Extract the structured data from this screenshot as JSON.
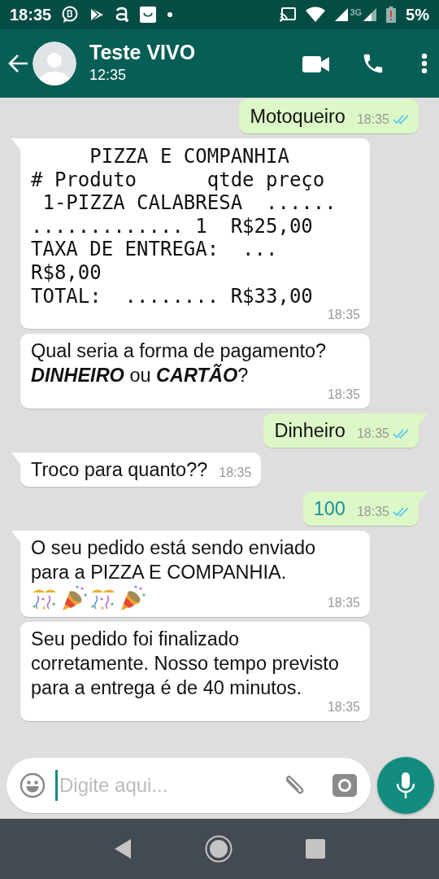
{
  "status_bar": {
    "time": "18:35",
    "battery": "5%",
    "network": "3G"
  },
  "header": {
    "title": "Teste VIVO",
    "subtitle": "12:35"
  },
  "messages": [
    {
      "outgoing": true,
      "kind": "text",
      "text": "Motoqueiro",
      "time": "18:35",
      "read": true,
      "tail": false
    },
    {
      "outgoing": false,
      "kind": "mono",
      "lines": [
        "     PIZZA E COMPANHIA",
        "# Produto      qtde preço",
        " 1-PIZZA CALABRESA  ......",
        "............. 1  R$25,00",
        "TAXA DE ENTREGA:  ...",
        "R$8,00",
        "TOTAL:  ........ R$33,00"
      ],
      "time": "18:35",
      "tail": true
    },
    {
      "outgoing": false,
      "kind": "text",
      "text": "Qual seria a forma de pagamento? **DINHEIRO** ou **CARTÃO**?",
      "time": "18:35",
      "tail": false
    },
    {
      "outgoing": true,
      "kind": "text",
      "text": "Dinheiro",
      "time": "18:35",
      "read": true,
      "tail": true
    },
    {
      "outgoing": false,
      "kind": "text",
      "text": "Troco para quanto??",
      "time": "18:35",
      "tail": true
    },
    {
      "outgoing": true,
      "kind": "text",
      "text": "100",
      "time": "18:35",
      "read": true,
      "tail": true,
      "linked": true
    },
    {
      "outgoing": false,
      "kind": "text",
      "text": "O seu pedido está sendo enviado para a PIZZA E COMPANHIA.",
      "emoji": [
        {
          "kind": "confetti"
        },
        {
          "kind": "popper"
        },
        {
          "kind": "confetti"
        },
        {
          "kind": "popper"
        }
      ],
      "time": "18:35",
      "tail": true
    },
    {
      "outgoing": false,
      "kind": "text",
      "text": "Seu pedido foi finalizado corretamente. Nosso tempo previsto para a entrega é de 40 minutos.",
      "time": "18:35",
      "tail": false
    }
  ],
  "composer": {
    "placeholder": "Digite aqui..."
  }
}
